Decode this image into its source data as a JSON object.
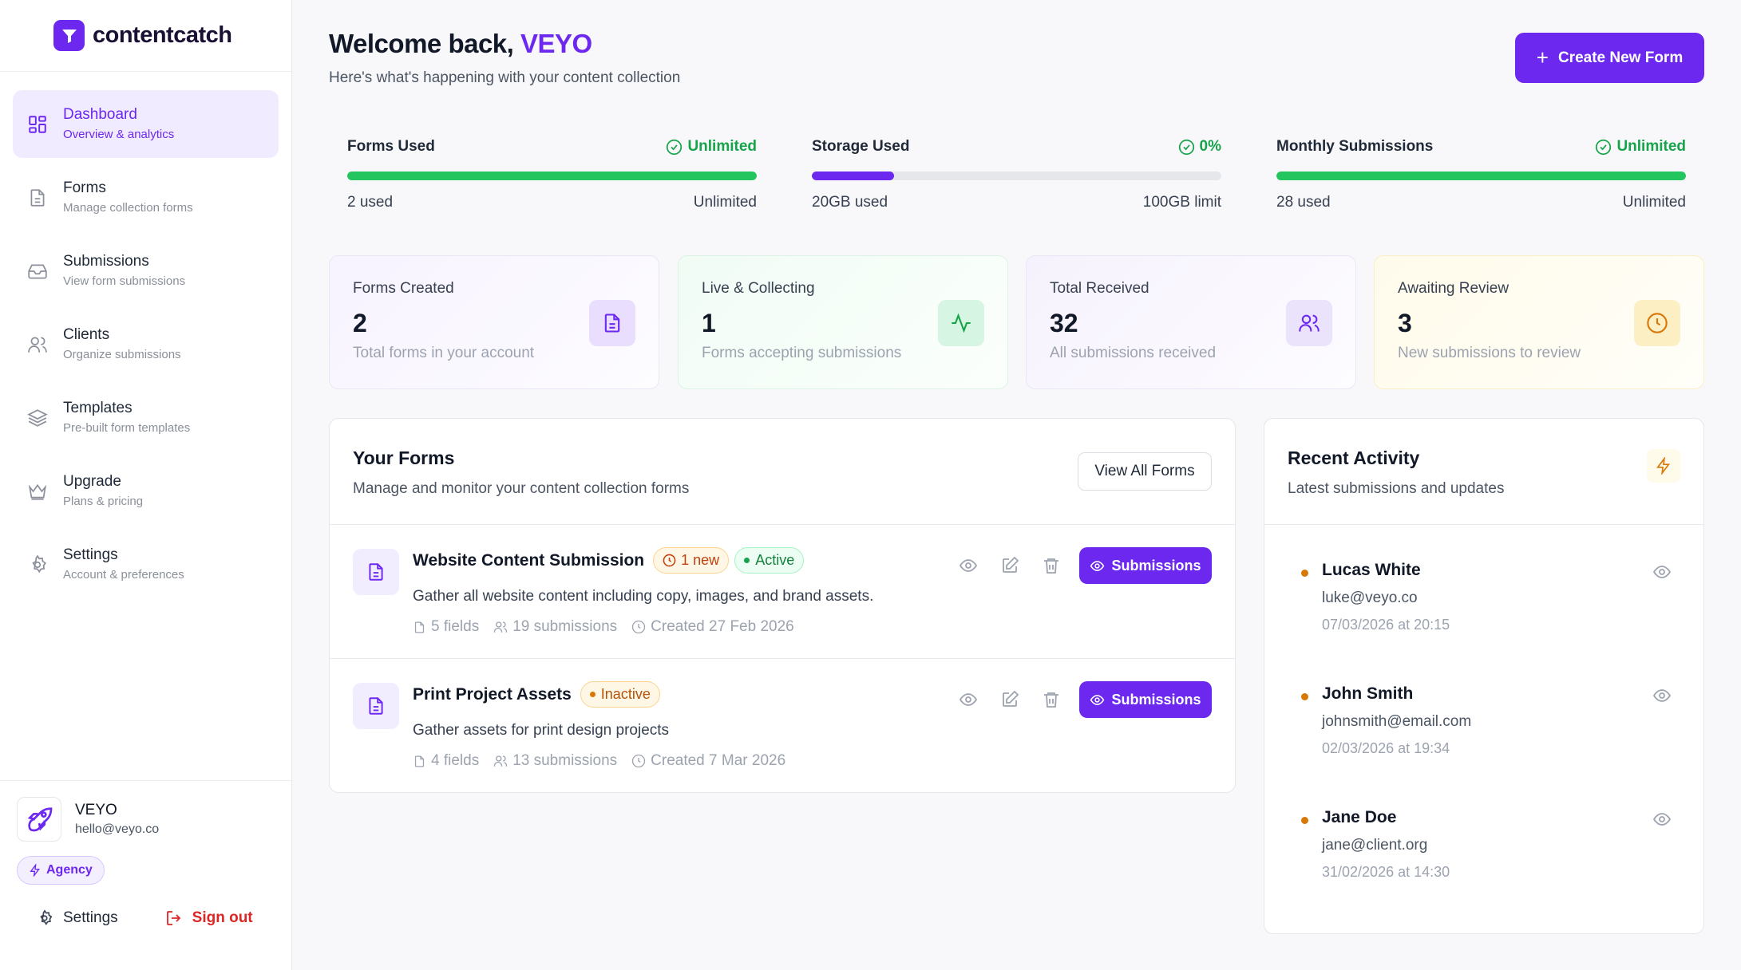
{
  "brand": {
    "name": "contentcatch"
  },
  "sidebar": {
    "items": [
      {
        "title": "Dashboard",
        "sub": "Overview & analytics",
        "icon": "dashboard-icon"
      },
      {
        "title": "Forms",
        "sub": "Manage collection forms",
        "icon": "file-icon"
      },
      {
        "title": "Submissions",
        "sub": "View form submissions",
        "icon": "inbox-icon"
      },
      {
        "title": "Clients",
        "sub": "Organize submissions",
        "icon": "users-icon"
      },
      {
        "title": "Templates",
        "sub": "Pre-built form templates",
        "icon": "layers-icon"
      },
      {
        "title": "Upgrade",
        "sub": "Plans & pricing",
        "icon": "crown-icon"
      },
      {
        "title": "Settings",
        "sub": "Account & preferences",
        "icon": "gear-icon"
      }
    ],
    "active_index": 0
  },
  "user": {
    "name": "VEYO",
    "email": "hello@veyo.co",
    "plan": "Agency",
    "settings_label": "Settings",
    "signout_label": "Sign out"
  },
  "header": {
    "welcome_prefix": "Welcome back,",
    "welcome_name": "VEYO",
    "subtitle": "Here's what's happening with your content collection",
    "create_label": "Create New Form"
  },
  "usage": [
    {
      "label": "Forms Used",
      "status": "Unlimited",
      "left": "2 used",
      "right": "Unlimited",
      "fill_pct": 100,
      "color": "#22c55e"
    },
    {
      "label": "Storage Used",
      "status": "0%",
      "left": "20GB used",
      "right": "100GB limit",
      "fill_pct": 20,
      "color": "#6d28f0"
    },
    {
      "label": "Monthly Submissions",
      "status": "Unlimited",
      "left": "28 used",
      "right": "Unlimited",
      "fill_pct": 100,
      "color": "#22c55e"
    }
  ],
  "stats": [
    {
      "label": "Forms Created",
      "value": "2",
      "sub": "Total forms in your account",
      "icon": "document-icon"
    },
    {
      "label": "Live & Collecting",
      "value": "1",
      "sub": "Forms accepting submissions",
      "icon": "activity-icon"
    },
    {
      "label": "Total Received",
      "value": "32",
      "sub": "All submissions received",
      "icon": "users-icon"
    },
    {
      "label": "Awaiting Review",
      "value": "3",
      "sub": "New submissions to review",
      "icon": "clock-icon"
    }
  ],
  "forms_card": {
    "title": "Your Forms",
    "subtitle": "Manage and monitor your content collection forms",
    "view_all": "View All Forms",
    "forms": [
      {
        "title": "Website Content Submission",
        "new_badge": "1 new",
        "status": "Active",
        "desc": "Gather all website content including copy, images, and brand assets.",
        "fields": "5 fields",
        "submissions": "19 submissions",
        "created": "Created 27 Feb 2026",
        "button": "Submissions"
      },
      {
        "title": "Print Project Assets",
        "status": "Inactive",
        "desc": "Gather assets for print design projects",
        "fields": "4 fields",
        "submissions": "13 submissions",
        "created": "Created 7 Mar 2026",
        "button": "Submissions"
      }
    ]
  },
  "activity": {
    "title": "Recent Activity",
    "subtitle": "Latest submissions and updates",
    "items": [
      {
        "name": "Lucas White",
        "email": "luke@veyo.co",
        "time": "07/03/2026 at 20:15"
      },
      {
        "name": "John Smith",
        "email": "johnsmith@email.com",
        "time": "02/03/2026 at 19:34"
      },
      {
        "name": "Jane Doe",
        "email": "jane@client.org",
        "time": "31/02/2026 at 14:30"
      }
    ]
  },
  "colors": {
    "accent": "#6d28f0",
    "success": "#16a34a",
    "warning": "#d97706",
    "danger": "#dc2626"
  }
}
